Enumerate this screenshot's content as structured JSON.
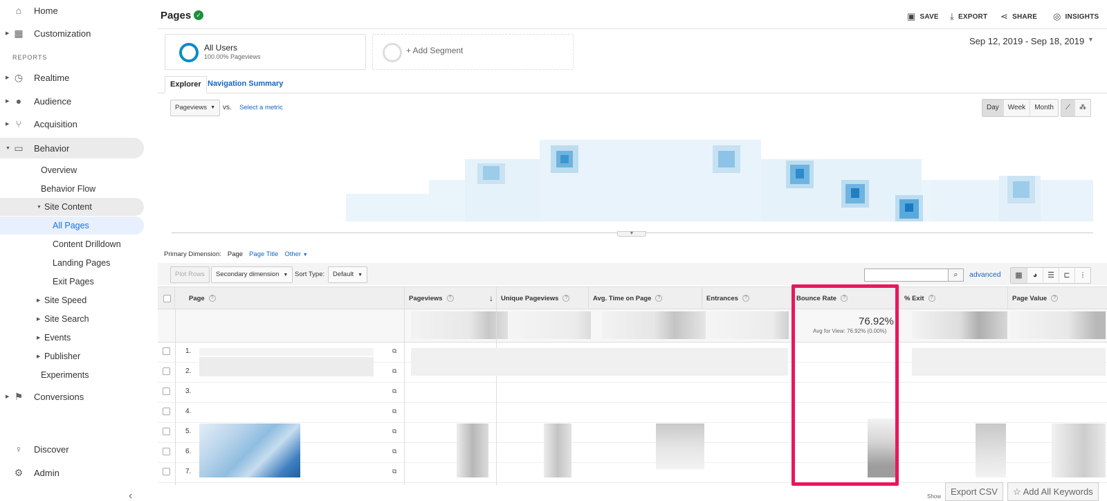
{
  "sidebar": {
    "home": "Home",
    "customization": "Customization",
    "reports_heading": "REPORTS",
    "realtime": "Realtime",
    "audience": "Audience",
    "acquisition": "Acquisition",
    "behavior": "Behavior",
    "behavior_items": {
      "overview": "Overview",
      "behavior_flow": "Behavior Flow",
      "site_content": "Site Content",
      "all_pages": "All Pages",
      "content_drilldown": "Content Drilldown",
      "landing_pages": "Landing Pages",
      "exit_pages": "Exit Pages",
      "site_speed": "Site Speed",
      "site_search": "Site Search",
      "events": "Events",
      "publisher": "Publisher",
      "experiments": "Experiments"
    },
    "conversions": "Conversions",
    "discover": "Discover",
    "admin": "Admin"
  },
  "header": {
    "title": "Pages",
    "save": "SAVE",
    "export": "EXPORT",
    "share": "SHARE",
    "insights": "INSIGHTS"
  },
  "segments": {
    "all_users": "All Users",
    "all_users_sub": "100.00% Pageviews",
    "add_segment": "+ Add Segment"
  },
  "date_range": "Sep 12, 2019 - Sep 18, 2019",
  "tabs": {
    "explorer": "Explorer",
    "navigation_summary": "Navigation Summary"
  },
  "chart_controls": {
    "metric": "Pageviews",
    "vs": "vs.",
    "select_metric": "Select a metric",
    "day": "Day",
    "week": "Week",
    "month": "Month"
  },
  "dimensions": {
    "label": "Primary Dimension:",
    "page": "Page",
    "page_title": "Page Title",
    "other": "Other"
  },
  "toolbar": {
    "plot_rows": "Plot Rows",
    "secondary_dimension": "Secondary dimension",
    "sort_type_label": "Sort Type:",
    "sort_type_value": "Default",
    "advanced": "advanced"
  },
  "table": {
    "columns": [
      "Page",
      "Pageviews",
      "Unique Pageviews",
      "Avg. Time on Page",
      "Entrances",
      "Bounce Rate",
      "% Exit",
      "Page Value"
    ],
    "bounce_rate_total": "76.92%",
    "bounce_rate_avg": "Avg for View: 76.92% (0.00%)",
    "row_numbers": [
      "1.",
      "2.",
      "3.",
      "4.",
      "5.",
      "6.",
      "7."
    ]
  },
  "footer": {
    "show": "Show",
    "export_csv": "Export CSV",
    "add_all_keywords": "Add All Keywords"
  },
  "colors": {
    "accent_blue": "#058dc7",
    "link_blue": "#1565c0",
    "highlight": "#e8175d",
    "verified_green": "#1e8e3e"
  }
}
